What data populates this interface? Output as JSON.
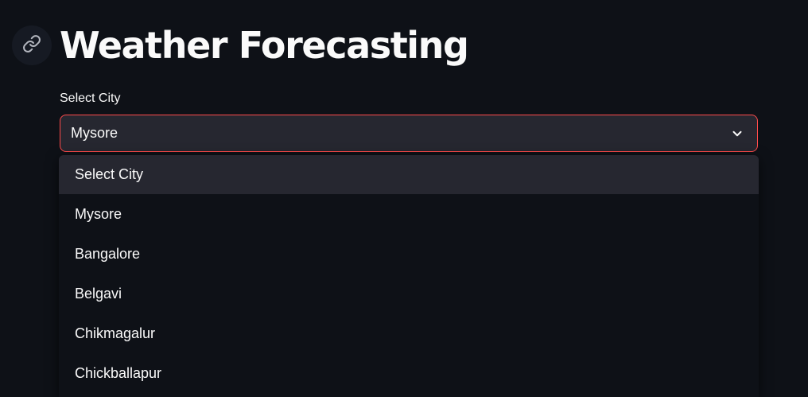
{
  "header": {
    "title": "Weather Forecasting",
    "anchor_icon": "link-icon"
  },
  "city_select": {
    "label": "Select City",
    "selected_value": "Mysore",
    "chevron_icon": "chevron-down-icon",
    "options": [
      "Select City",
      "Mysore",
      "Bangalore",
      "Belgavi",
      "Chikmagalur",
      "Chickballapur"
    ],
    "highlighted_index": 0
  },
  "colors": {
    "background": "#0e1117",
    "input_background": "#262730",
    "focus_border": "#ff4b4b",
    "text": "#fafafa"
  }
}
